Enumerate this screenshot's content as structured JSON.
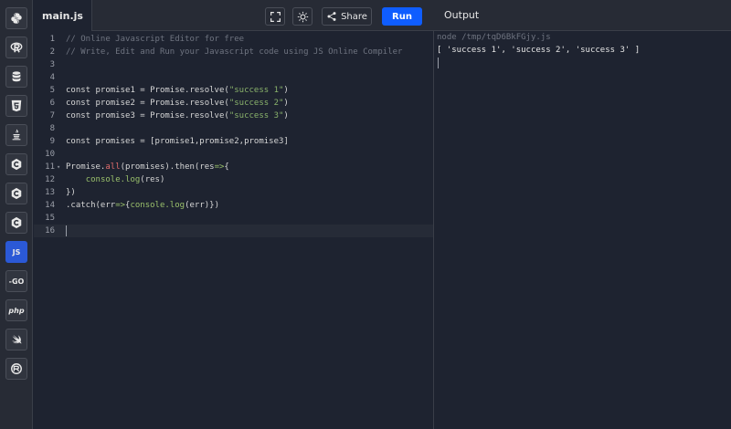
{
  "sidebar": {
    "items": [
      {
        "name": "python",
        "icon": "python-icon"
      },
      {
        "name": "r",
        "icon": "r-icon"
      },
      {
        "name": "sql",
        "icon": "database-icon"
      },
      {
        "name": "html",
        "icon": "html5-icon"
      },
      {
        "name": "java",
        "icon": "java-icon"
      },
      {
        "name": "c",
        "icon": "c-icon",
        "label": "C"
      },
      {
        "name": "cpp",
        "icon": "cpp-icon",
        "label": "C"
      },
      {
        "name": "csharp",
        "icon": "csharp-icon",
        "label": "C"
      },
      {
        "name": "javascript",
        "icon": "js-icon",
        "label": "JS",
        "active": true
      },
      {
        "name": "go",
        "icon": "go-icon",
        "label": "-GO"
      },
      {
        "name": "php",
        "icon": "php-icon",
        "label": "php"
      },
      {
        "name": "swift",
        "icon": "swift-icon"
      },
      {
        "name": "rust",
        "icon": "rust-icon"
      }
    ]
  },
  "header": {
    "file_tab": "main.js",
    "share_label": "Share",
    "run_label": "Run",
    "output_title": "Output"
  },
  "editor": {
    "line_numbers": [
      "1",
      "2",
      "3",
      "4",
      "5",
      "6",
      "7",
      "8",
      "9",
      "10",
      "11",
      "12",
      "13",
      "14",
      "15",
      "16"
    ],
    "lines": [
      "// Online Javascript Editor for free",
      "// Write, Edit and Run your Javascript code using JS Online Compiler",
      "",
      "",
      "const promise1 = Promise.resolve(\"success 1\")",
      "const promise2 = Promise.resolve(\"success 2\")",
      "const promise3 = Promise.resolve(\"success 3\")",
      "",
      "const promises = [promise1,promise2,promise3]",
      "",
      "Promise.all(promises).then(res=>{",
      "    console.log(res)",
      "})",
      ".catch(err=>{console.log(err)})",
      "",
      ""
    ]
  },
  "output": {
    "command": "node /tmp/tqD6BkFGjy.js",
    "result": "[ 'success 1', 'success 2', 'success 3' ]"
  },
  "colors": {
    "run_button": "#0f5dff",
    "active_language": "#2b59d6",
    "string": "#8ab36b",
    "comment": "#6f7480"
  }
}
